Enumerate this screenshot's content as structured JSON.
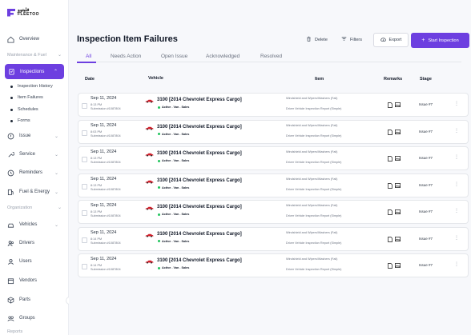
{
  "brand": {
    "arabic": "فليتوو",
    "english": "FLEETOO"
  },
  "sidebar": {
    "overview": "Overview",
    "section_maintenance": "Maintenance & Fuel",
    "inspections": "Inspections",
    "sub_items": [
      "Inspection History",
      "Item Failures",
      "Schedules",
      "Forms"
    ],
    "issue": "Issue",
    "service": "Service",
    "reminders": "Reminders",
    "fuel_energy": "Fuel & Energy",
    "section_org": "Organization",
    "vehicles": "Vehicles",
    "drivers": "Drivers",
    "users": "Users",
    "vendors": "Vendors",
    "parts": "Parts",
    "groups": "Groups",
    "section_bottom": "Reports",
    "collapse": "‹"
  },
  "header": {
    "title": "Inspection Item Failures",
    "delete": "Delete",
    "filters": "Filters",
    "export": "Export",
    "start": "Start Inspection"
  },
  "tabs": [
    "All",
    "Needs Action",
    "Open Issue",
    "Acknowledged",
    "Resolved"
  ],
  "table": {
    "columns": {
      "date": "Date",
      "vehicle": "Vehicle",
      "item": "Item",
      "remarks": "Remarks",
      "stage": "Stage"
    },
    "rows": [
      {
        "date": "Sep 11, 2024",
        "time": "8:13 PM",
        "submission": "Submission #1087804",
        "vehicle": "3100 [2014 Chevrolet Express Cargo]",
        "status": "Active . Van . Sales",
        "item1": "Windshield and Wipers/Washers (Fail)",
        "item2": "Driver Vehicle Inspection Report (Simple)",
        "stage": "Issue #7"
      },
      {
        "date": "Sep 11, 2024",
        "time": "8:03 PM",
        "submission": "Submission #1087804",
        "vehicle": "3100 [2014 Chevrolet Express Cargo]",
        "status": "Active . Van . Sales",
        "item1": "Windshield and Wipers/Washers (Fail)",
        "item2": "Driver Vehicle Inspection Report (Simple)",
        "stage": "Issue #7"
      },
      {
        "date": "Sep 11, 2024",
        "time": "8:13 PM",
        "submission": "Submission #1087804",
        "vehicle": "3100 [2014 Chevrolet Express Cargo]",
        "status": "Active . Van . Sales",
        "item1": "Windshield and Wipers/Washers (Fail)",
        "item2": "Driver Vehicle Inspection Report (Simple)",
        "stage": "Issue #7"
      },
      {
        "date": "Sep 11, 2024",
        "time": "8:13 PM",
        "submission": "Submission #1087804",
        "vehicle": "3100 [2014 Chevrolet Express Cargo]",
        "status": "Active . Van . Sales",
        "item1": "Windshield and Wipers/Washers (Fail)",
        "item2": "Driver Vehicle Inspection Report (Simple)",
        "stage": "Issue #7"
      },
      {
        "date": "Sep 11, 2024",
        "time": "8:13 PM",
        "submission": "Submission #1087804",
        "vehicle": "3100 [2014 Chevrolet Express Cargo]",
        "status": "Active . Van . Sales",
        "item1": "Windshield and Wipers/Washers (Fail)",
        "item2": "Driver Vehicle Inspection Report (Simple)",
        "stage": "Issue #7"
      },
      {
        "date": "Sep 11, 2024",
        "time": "8:14 PM",
        "submission": "Submission #1087804",
        "vehicle": "3100 [2014 Chevrolet Express Cargo]",
        "status": "Active . Van . Sales",
        "item1": "Windshield and Wipers/Washers (Fail)",
        "item2": "Driver Vehicle Inspection Report (Simple)",
        "stage": "Issue #7"
      },
      {
        "date": "Sep 11, 2024",
        "time": "8:14 PM",
        "submission": "Submission #1087804",
        "vehicle": "3100 [2014 Chevrolet Express Cargo]",
        "status": "Active . Van . Sales",
        "item1": "Windshield and Wipers/Washers (Fail)",
        "item2": "Driver Vehicle Inspection Report (Simple)",
        "stage": "Issue #7"
      }
    ]
  },
  "colors": {
    "accent": "#6d3fe0",
    "car": "#d11f2a",
    "active": "#22c55e"
  }
}
